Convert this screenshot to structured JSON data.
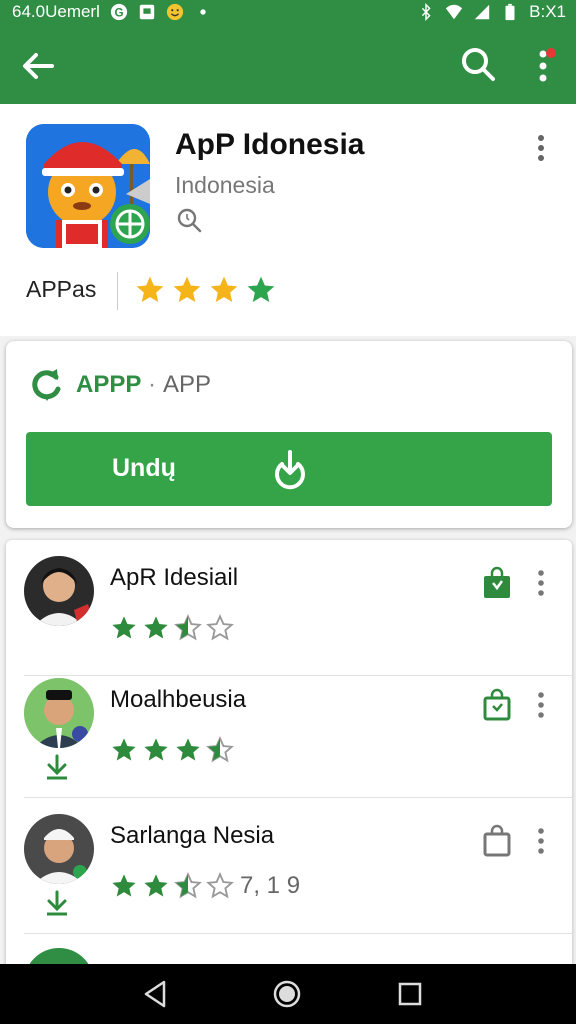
{
  "status_bar": {
    "left_text": "64.0Uemerl",
    "right_text": "B:X1",
    "icons": [
      "google-icon",
      "message-icon",
      "emoji-icon",
      "dot-icon",
      "bluetooth-icon",
      "wifi-icon",
      "signal-icon",
      "battery-icon"
    ]
  },
  "app_bar": {
    "back_icon": "arrow-left-icon",
    "search_icon": "search-icon",
    "menu_icon": "more-vert-icon",
    "colors": {
      "bar": "#2f8e44",
      "notification_dot": "#e53935"
    }
  },
  "app_header": {
    "name": "ApP Idonesia",
    "subtitle": "Indonesia",
    "category_label": "APPas",
    "rating_stars": 4,
    "icon": "cartoon-app-icon"
  },
  "install_card": {
    "brand_label": "APPP",
    "separator": "·",
    "brand_label_2": "APP",
    "button_label": "Undų",
    "button_icon": "download-icon",
    "colors": {
      "button": "#35a347"
    }
  },
  "reviews": [
    {
      "name": "ApR Idesiail",
      "stars": 2.5,
      "rating_text": "",
      "bag_icon": "shopping-bag-filled-icon",
      "has_download_icon": false
    },
    {
      "name": "Moalhbeusia",
      "stars": 3.5,
      "rating_text": "",
      "bag_icon": "shopping-bag-outline-icon",
      "has_download_icon": true
    },
    {
      "name": "Sarlanga Nesia",
      "stars": 2.5,
      "rating_text": "7, 1 9",
      "bag_icon": "shopping-bag-gray-icon",
      "has_download_icon": true
    }
  ],
  "nav_bar": {
    "icons": [
      "nav-back-icon",
      "nav-home-icon",
      "nav-recents-icon"
    ]
  }
}
